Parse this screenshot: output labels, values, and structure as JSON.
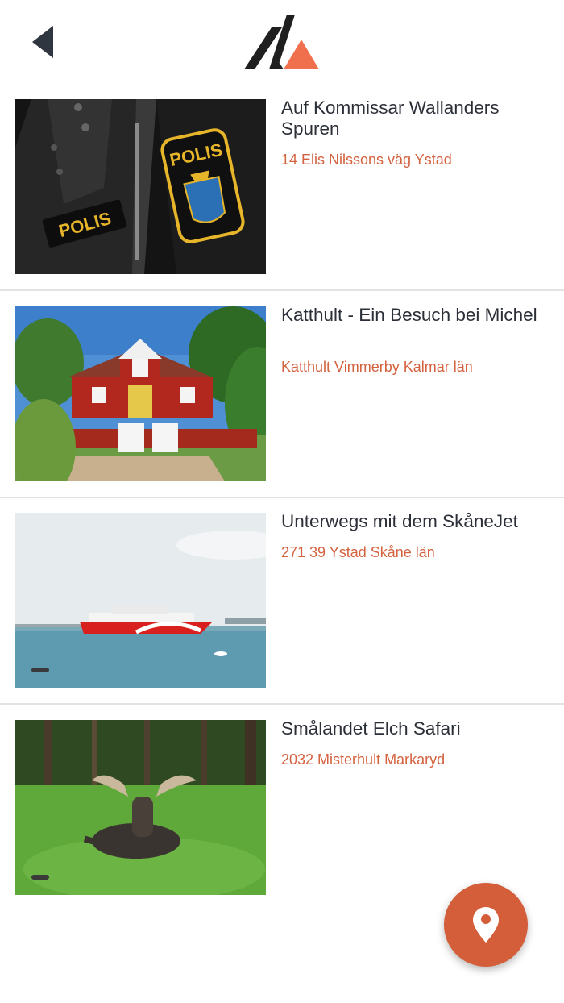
{
  "header": {
    "back_icon": "chevron-left-icon",
    "logo": "mountain-logo"
  },
  "items": [
    {
      "title": "Auf Kommissar Wallanders Spuren",
      "address": "14 Elis Nilssons väg Ystad",
      "image": "police-jacket-photo"
    },
    {
      "title": "Katthult - Ein Besuch bei Michel",
      "address": "Katthult Vimmerby Kalmar län",
      "image": "red-house-photo"
    },
    {
      "title": "Unterwegs mit dem SkåneJet",
      "address": "271 39 Ystad Skåne län",
      "image": "ferry-photo"
    },
    {
      "title": "Smålandet Elch Safari",
      "address": "2032 Misterhult Markaryd",
      "image": "moose-photo"
    }
  ],
  "fab": {
    "icon": "map-pin-icon"
  },
  "colors": {
    "accent": "#d45d3a",
    "text": "#2b2f38",
    "divider": "#e2e2e2"
  }
}
